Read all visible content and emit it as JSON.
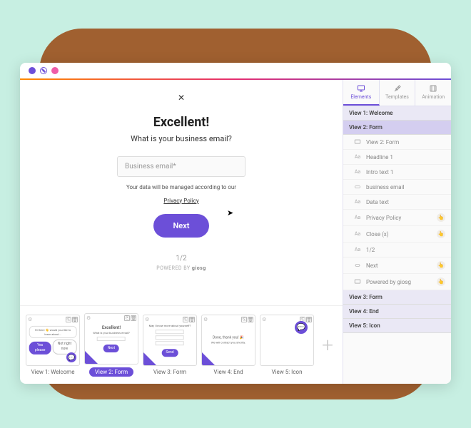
{
  "side_tabs": {
    "elements": "Elements",
    "templates": "Templates",
    "animation": "Animation"
  },
  "preview": {
    "headline": "Excellent!",
    "intro": "What is your business email?",
    "placeholder": "Business email*",
    "datatext": "Your data will be managed according to our",
    "privacy": "Privacy Policy",
    "next": "Next",
    "pager": "1/2",
    "powered_prefix": "POWERED BY ",
    "powered_brand": "giosg"
  },
  "layers": {
    "groups": [
      {
        "label": "View 1: Welcome"
      },
      {
        "label": "View 2: Form",
        "expanded": true,
        "items": [
          {
            "icon": "view",
            "label": "View 2: Form"
          },
          {
            "icon": "text",
            "label": "Headline 1"
          },
          {
            "icon": "text",
            "label": "Intro text 1"
          },
          {
            "icon": "input",
            "label": "business email"
          },
          {
            "icon": "text",
            "label": "Data text"
          },
          {
            "icon": "text",
            "label": "Privacy Policy",
            "action": true
          },
          {
            "icon": "text",
            "label": "Close (x)",
            "action": true
          },
          {
            "icon": "text",
            "label": "1/2"
          },
          {
            "icon": "button",
            "label": "Next",
            "action": true
          },
          {
            "icon": "view",
            "label": "Powered by giosg",
            "action": true
          }
        ]
      },
      {
        "label": "View 3: Form"
      },
      {
        "label": "View 4: End"
      },
      {
        "label": "View 5: Icon"
      }
    ]
  },
  "thumbs": [
    {
      "label": "View 1: Welcome"
    },
    {
      "label": "View 2: Form",
      "active": true
    },
    {
      "label": "View 3: Form"
    },
    {
      "label": "View 4: End"
    },
    {
      "label": "View 5: Icon"
    }
  ]
}
